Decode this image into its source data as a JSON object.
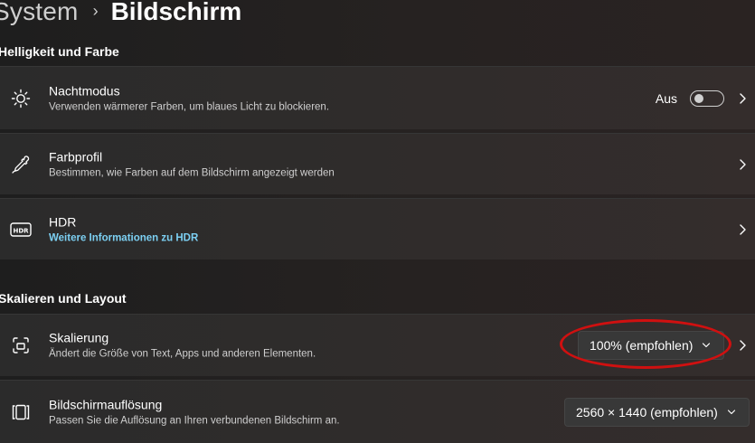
{
  "breadcrumb": {
    "parent": "System",
    "separator": "›",
    "current": "Bildschirm"
  },
  "sections": {
    "brightness_color": "Helligkeit und Farbe",
    "scale_layout": "Skalieren und Layout"
  },
  "night_mode": {
    "icon": "brightness-icon",
    "title": "Nachtmodus",
    "description": "Verwenden wärmerer Farben, um blaues Licht zu blockieren.",
    "toggle_label": "Aus",
    "toggle_on": false
  },
  "color_profile": {
    "icon": "eyedropper-icon",
    "title": "Farbprofil",
    "description": "Bestimmen, wie Farben auf dem Bildschirm angezeigt werden"
  },
  "hdr": {
    "icon": "hdr-icon",
    "title": "HDR",
    "link": "Weitere Informationen zu HDR"
  },
  "scaling": {
    "icon": "scale-icon",
    "title": "Skalierung",
    "description": "Ändert die Größe von Text, Apps und anderen Elementen.",
    "selected": "100% (empfohlen)"
  },
  "resolution": {
    "icon": "resolution-icon",
    "title": "Bildschirmauflösung",
    "description": "Passen Sie die Auflösung an Ihren verbundenen Bildschirm an.",
    "selected": "2560 × 1440 (empfohlen)"
  },
  "colors": {
    "link": "#7cd0f3",
    "annotation": "#d01010"
  }
}
